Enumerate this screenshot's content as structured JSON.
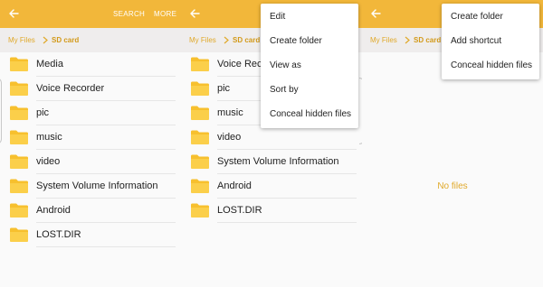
{
  "screens": [
    {
      "appbar": {
        "actions": [
          "SEARCH",
          "MORE"
        ]
      },
      "breadcrumb": {
        "root": "My Files",
        "current": "SD card"
      },
      "folders": [
        "Media",
        "Voice Recorder",
        "pic",
        "music",
        "video",
        "System Volume Information",
        "Android",
        "LOST.DIR"
      ]
    },
    {
      "breadcrumb": {
        "root": "My Files",
        "current": "SD card"
      },
      "folders": [
        "Voice Recorder",
        "pic",
        "music",
        "video",
        "System Volume Information",
        "Android",
        "LOST.DIR"
      ],
      "menu": [
        "Edit",
        "Create folder",
        "View as",
        "Sort by",
        "Conceal hidden files"
      ]
    },
    {
      "breadcrumb": {
        "root": "My Files",
        "current": "SD card"
      },
      "empty_text": "No files",
      "menu": [
        "Create folder",
        "Add shortcut",
        "Conceal hidden files"
      ]
    }
  ],
  "colors": {
    "accent": "#f2b73a",
    "folder": "#f7c02e",
    "crumb": "#e0a92a",
    "background": "#fafafa"
  },
  "icons": {
    "back": "back-arrow-icon",
    "folder": "folder-icon",
    "breadcrumb_separator": "chevron-right-icon"
  }
}
